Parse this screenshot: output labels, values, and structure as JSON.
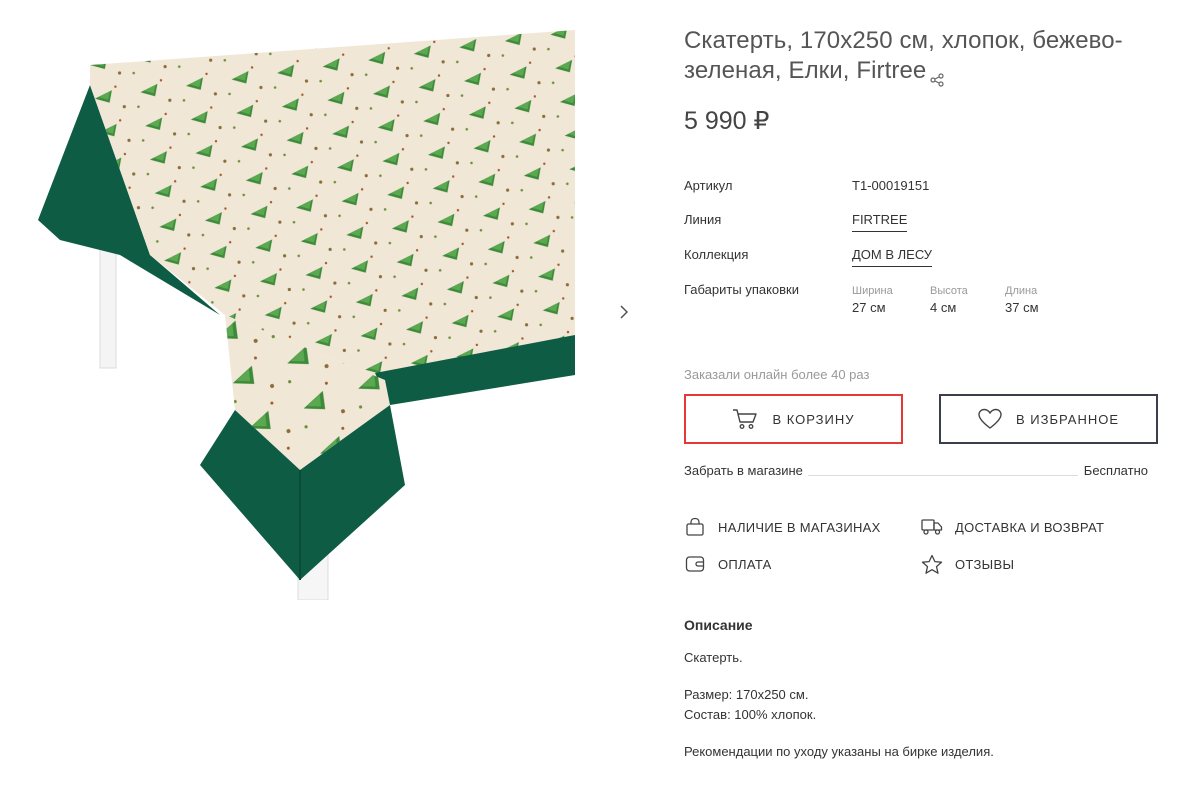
{
  "product": {
    "title": "Скатерть, 170x250 см, хлопок, бежево-зеленая, Елки, Firtree",
    "price": "5 990 ₽",
    "image_alt": "Скатерть с узором из елок"
  },
  "specs": {
    "article_label": "Артикул",
    "article_value": "T1-00019151",
    "line_label": "Линия",
    "line_value": "FIRTREE",
    "collection_label": "Коллекция",
    "collection_value": "ДОМ В ЛЕСУ",
    "package_label": "Габариты упаковки",
    "dimensions": [
      {
        "label": "Ширина",
        "value": "27 см"
      },
      {
        "label": "Высота",
        "value": "4 см"
      },
      {
        "label": "Длина",
        "value": "37 см"
      }
    ]
  },
  "ordered_text": "Заказали онлайн более 40 раз",
  "buttons": {
    "cart_label": "В КОРЗИНУ",
    "favorite_label": "В ИЗБРАННОЕ"
  },
  "pickup": {
    "label": "Забрать в магазине",
    "value": "Бесплатно"
  },
  "links": {
    "stores": "НАЛИЧИЕ В МАГАЗИНАХ",
    "delivery": "ДОСТАВКА И ВОЗВРАТ",
    "payment": "ОПЛАТА",
    "reviews": "ОТЗЫВЫ"
  },
  "description": {
    "title": "Описание",
    "p1": "Скатерть.",
    "p2": "Размер: 170x250 см.",
    "p3": "Состав: 100% хлопок.",
    "p4": "Рекомендации по уходу указаны на бирке изделия."
  },
  "icons": {
    "share": "share-icon",
    "next": "chevron-right-icon",
    "cart": "cart-icon",
    "heart": "heart-icon",
    "bag": "bag-icon",
    "truck": "truck-icon",
    "wallet": "wallet-icon",
    "star": "star-icon"
  },
  "colors": {
    "accent_red": "#e53935",
    "cloth_green": "#0f5c45",
    "cloth_beige": "#f1e7d6",
    "tree_green": "#3d8a3a"
  }
}
